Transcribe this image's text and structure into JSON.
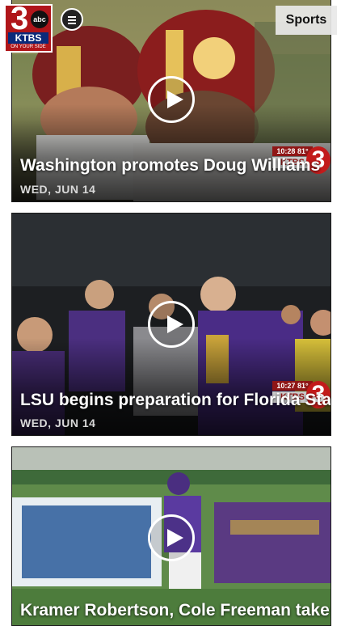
{
  "header": {
    "logo": {
      "channel": "3",
      "network": "abc",
      "station": "KTBS",
      "slogan": "ON YOUR SIDE"
    },
    "menu_icon": "hamburger-menu-icon",
    "section": "Sports"
  },
  "colors": {
    "brand_red": "#b0161a",
    "brand_blue": "#0a2a7a",
    "headline": "#ffffff"
  },
  "videos": [
    {
      "headline": "Washington promotes Doug Williams",
      "date": "WED, JUN 14",
      "bug": {
        "time": "10:28",
        "temp": "81°",
        "channel": "KTBS",
        "number": "3"
      }
    },
    {
      "headline": "LSU begins preparation for Florida State",
      "date": "WED, JUN 14",
      "bug": {
        "time": "10:27",
        "temp": "81°",
        "channel": "KTBS",
        "number": "3"
      }
    },
    {
      "headline": "Kramer Robertson, Cole Freeman take leadership roles"
    }
  ]
}
